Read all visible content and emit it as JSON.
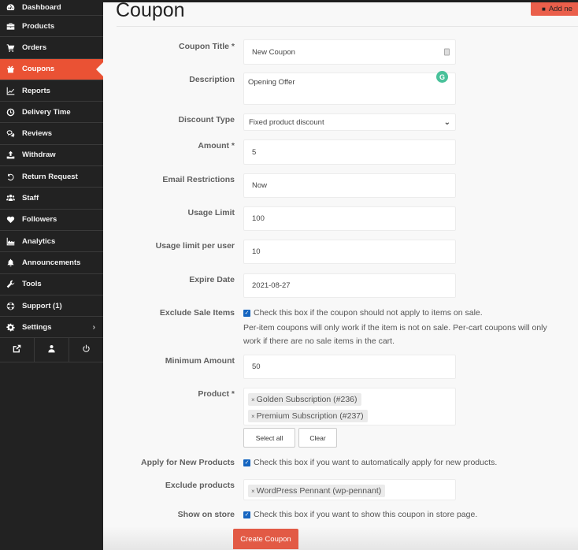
{
  "sidebar": {
    "items": [
      {
        "label": "Dashboard",
        "icon": "dashboard-icon",
        "glyph": "⚙"
      },
      {
        "label": "Products",
        "icon": "briefcase-icon",
        "glyph": "▬"
      },
      {
        "label": "Orders",
        "icon": "cart-icon",
        "glyph": "🛒"
      },
      {
        "label": "Coupons",
        "icon": "gift-icon",
        "glyph": "🎁",
        "active": true
      },
      {
        "label": "Reports",
        "icon": "line-chart-icon",
        "glyph": "📈"
      },
      {
        "label": "Delivery Time",
        "icon": "clock-icon",
        "glyph": "◷"
      },
      {
        "label": "Reviews",
        "icon": "comments-icon",
        "glyph": "💬"
      },
      {
        "label": "Withdraw",
        "icon": "upload-icon",
        "glyph": "⤒"
      },
      {
        "label": "Return Request",
        "icon": "undo-icon",
        "glyph": "↺"
      },
      {
        "label": "Staff",
        "icon": "users-icon",
        "glyph": "👥"
      },
      {
        "label": "Followers",
        "icon": "heart-icon",
        "glyph": "♥"
      },
      {
        "label": "Analytics",
        "icon": "area-chart-icon",
        "glyph": "📊"
      },
      {
        "label": "Announcements",
        "icon": "bell-icon",
        "glyph": "🔔"
      },
      {
        "label": "Tools",
        "icon": "wrench-icon",
        "glyph": "🔧"
      },
      {
        "label": "Support (1)",
        "icon": "life-ring-icon",
        "glyph": "⊕"
      },
      {
        "label": "Settings",
        "icon": "cog-icon",
        "glyph": "⚙",
        "chevron": "›"
      }
    ],
    "footer": [
      {
        "name": "external-link-icon",
        "glyph": "↗"
      },
      {
        "name": "user-icon",
        "glyph": "👤"
      },
      {
        "name": "power-icon",
        "glyph": "⏻"
      }
    ]
  },
  "header": {
    "title": "Coupon",
    "add_new_label": "Add ne"
  },
  "form": {
    "coupon_title": {
      "label": "Coupon Title *",
      "value": "New Coupon"
    },
    "description": {
      "label": "Description",
      "value": "Opening Offer"
    },
    "discount_type": {
      "label": "Discount Type",
      "value": "Fixed product discount"
    },
    "amount": {
      "label": "Amount *",
      "value": "5"
    },
    "email_restrictions": {
      "label": "Email Restrictions",
      "value": "Now"
    },
    "usage_limit": {
      "label": "Usage Limit",
      "value": "100"
    },
    "usage_limit_per_user": {
      "label": "Usage limit per user",
      "value": "10"
    },
    "expire_date": {
      "label": "Expire Date",
      "value": "2021-08-27"
    },
    "exclude_sale_items": {
      "label": "Exclude Sale Items",
      "checked": true,
      "check_text": "Check this box if the coupon should not apply to items on sale.",
      "help_text": "Per-item coupons will only work if the item is not on sale. Per-cart coupons will only work if there are no sale items in the cart."
    },
    "minimum_amount": {
      "label": "Minimum Amount",
      "value": "50"
    },
    "product": {
      "label": "Product *",
      "tags": [
        "Golden Subscription (#236)",
        "Premium Subscription (#237)"
      ],
      "select_all_label": "Select all",
      "clear_label": "Clear"
    },
    "apply_new_products": {
      "label": "Apply for New Products",
      "checked": true,
      "check_text": "Check this box if you want to automatically apply for new products."
    },
    "exclude_products": {
      "label": "Exclude products",
      "tags": [
        "WordPress Pennant (wp-pennant)"
      ]
    },
    "show_on_store": {
      "label": "Show on store",
      "checked": true,
      "check_text": "Check this box if you want to show this coupon in store page."
    },
    "submit_label": "Create Coupon"
  },
  "colors": {
    "accent": "#ea5234",
    "sidebar_bg": "#222222",
    "checkbox": "#1565c0",
    "grammarly": "#49c19a"
  }
}
